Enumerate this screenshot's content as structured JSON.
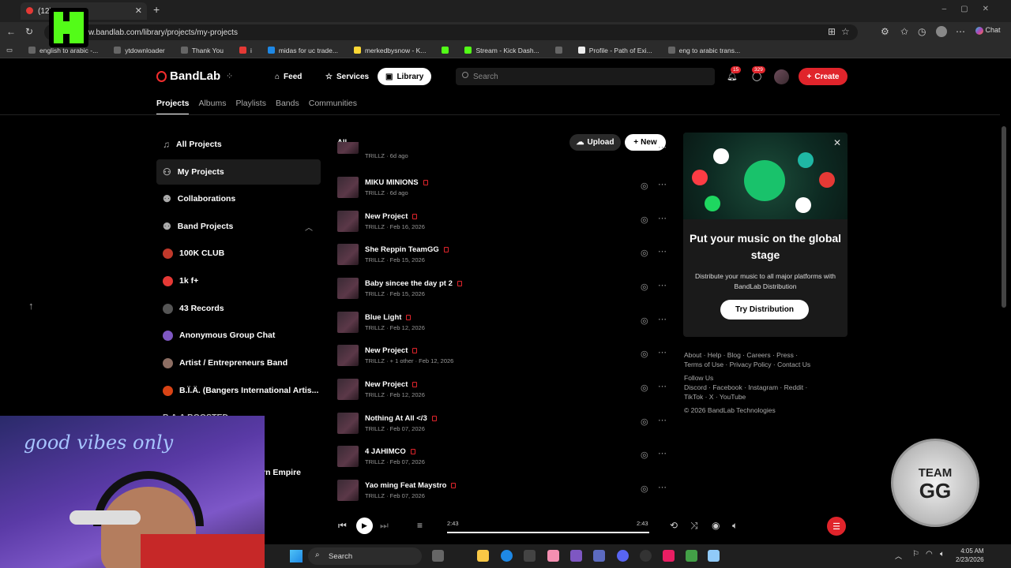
{
  "browser": {
    "tab_title": "(12)",
    "url": "w.bandlab.com/library/projects/my-projects",
    "chat_label": "Chat",
    "bookmarks": [
      "english to arabic -...",
      "ytdownloader",
      "Thank You",
      "i",
      "midas for uc trade...",
      "merkedbysnow - K...",
      "",
      "Stream - Kick Dash...",
      "",
      "Profile - Path of Exi...",
      "eng to arabic trans..."
    ]
  },
  "header": {
    "logo": "BandLab",
    "nav": [
      "Feed",
      "Services",
      "Library"
    ],
    "search_placeholder": "Search",
    "notif_count": "15",
    "msg_count": "329",
    "create_label": "Create"
  },
  "subnav": [
    "Projects",
    "Albums",
    "Playlists",
    "Bands",
    "Communities"
  ],
  "sidebar": {
    "items": [
      "All Projects",
      "My Projects",
      "Collaborations",
      "Band Projects"
    ],
    "bands": [
      "100K CLUB",
      "1k f+",
      "43 Records",
      "Anonymous Group Chat",
      "Artist / Entrepreneurs Band",
      "B.Ï.Ä. (Bangers International Artis..."
    ],
    "band_colors": [
      "#c0392b",
      "#e53935",
      "#555555",
      "#7e57c2",
      "#8d6e63",
      "#d84315"
    ],
    "partial_items": [
      "B.A.A BOOSTED",
      "rn Empire"
    ]
  },
  "content": {
    "filter": "All",
    "upload_label": "Upload",
    "new_label": "New",
    "projects": [
      {
        "name": "",
        "meta": "TRILLZ · 6d ago"
      },
      {
        "name": "MIKU MINIONS",
        "meta": "TRILLZ · 6d ago"
      },
      {
        "name": "New Project",
        "meta": "TRILLZ · Feb 16, 2026"
      },
      {
        "name": "She Reppin TeamGG",
        "meta": "TRILLZ · Feb 15, 2026"
      },
      {
        "name": "Baby sincee the day pt 2",
        "meta": "TRILLZ · Feb 15, 2026"
      },
      {
        "name": "Blue Light",
        "meta": "TRILLZ · Feb 12, 2026"
      },
      {
        "name": "New Project",
        "meta": "TRILLZ · + 1 other · Feb 12, 2026"
      },
      {
        "name": "New Project",
        "meta": "TRILLZ · Feb 12, 2026"
      },
      {
        "name": "Nothing At All </3",
        "meta": "TRILLZ · Feb 07, 2026"
      },
      {
        "name": "4 JAHIMCO",
        "meta": "TRILLZ · Feb 07, 2026"
      },
      {
        "name": "Yao ming Feat Maystro",
        "meta": "TRILLZ · Feb 07, 2026"
      }
    ]
  },
  "promo": {
    "title": "Put your music on the global stage",
    "body": "Distribute your music to all major platforms with BandLab Distribution",
    "cta": "Try Distribution"
  },
  "footer": {
    "line1": "About · Help · Blog · Careers · Press ·",
    "line2": "Terms of Use · Privacy Policy · Contact Us",
    "line3": "Follow Us",
    "line4": "Discord · Facebook · Instagram · Reddit ·",
    "line5": "TikTok · X · YouTube",
    "line6": "© 2026 BandLab Technologies"
  },
  "player": {
    "elapsed": "2:43",
    "duration": "2:43",
    "progress": 1.0
  },
  "taskbar": {
    "search_label": "Search",
    "time": "4:05 AM",
    "date": "2/23/2026"
  },
  "overlay": {
    "neon_text": "good vibes only",
    "badge_line1": "TEAM",
    "badge_line2": "GG"
  }
}
